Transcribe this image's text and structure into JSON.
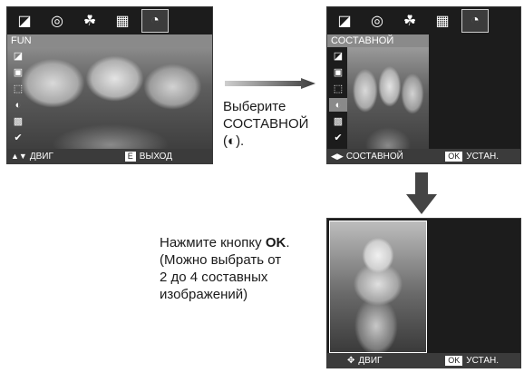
{
  "screen1": {
    "tabs": [
      {
        "icon": "◪",
        "name": "tab-icon-1"
      },
      {
        "icon": "◎",
        "name": "tab-icon-2"
      },
      {
        "icon": "☘",
        "name": "tab-icon-3"
      },
      {
        "icon": "▦",
        "name": "tab-icon-4"
      },
      {
        "icon": "◔",
        "name": "tab-icon-5"
      }
    ],
    "menu_label": "FUN",
    "bottom_left": "ДВИГ",
    "bottom_key": "E",
    "bottom_right": "ВЫХОД"
  },
  "screen2": {
    "menu_label": "СОСТАВНОЙ",
    "bottom_left": "СОСТАВНОЙ",
    "bottom_key": "OK",
    "bottom_right": "УСТАН."
  },
  "screen3": {
    "bottom_left": "ДВИГ",
    "bottom_key": "OK",
    "bottom_right": "УСТАН."
  },
  "menu_icons": [
    "◪",
    "▣",
    "⬚",
    "◐",
    "▩",
    "✔"
  ],
  "instruction1": {
    "line1": "Выберите",
    "line2": "СОСТАВНОЙ",
    "line3_open": "(",
    "line3_icon": "◐",
    "line3_close": ")."
  },
  "instruction2": {
    "prefix": "Нажмите кнопку ",
    "button": "OK",
    "suffix": ".",
    "line2": "(Можно выбрать от",
    "line3": "2 до 4 составных",
    "line4": "изображений)"
  },
  "colors": {
    "screen_bg": "#1c1c1c",
    "label_strip": "#8a8a8a",
    "bottom_bar": "#3b3b3b",
    "arrow": "#444444"
  }
}
